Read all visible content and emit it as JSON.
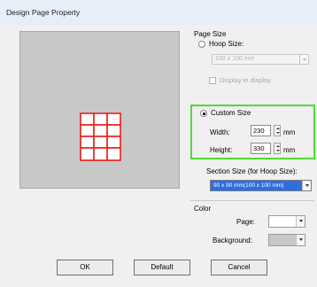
{
  "title": "Design Page Property",
  "page_size": {
    "group_label": "Page Size",
    "hoop_size_label": "Hoop Size:",
    "hoop_size_value": "100 x 100 mm",
    "show_hoop_label": "Display in display",
    "custom_size_label": "Custom Size",
    "width_label": "Width:",
    "width_value": "230",
    "width_unit": "mm",
    "height_label": "Height:",
    "height_value": "330",
    "height_unit": "mm",
    "section_size_label": "Section Size (for Hoop Size):",
    "section_size_value": "90 x 90 mm(100 x 100 mm)"
  },
  "color": {
    "group_label": "Color",
    "page_label": "Page:",
    "page_color": "#ffffff",
    "background_label": "Background:",
    "background_color": "#c8c8c8"
  },
  "buttons": {
    "ok": "OK",
    "default": "Default",
    "cancel": "Cancel"
  },
  "colors": {
    "highlight": "#52d83a",
    "grid": "#e8201c",
    "selection": "#2f6de0"
  }
}
